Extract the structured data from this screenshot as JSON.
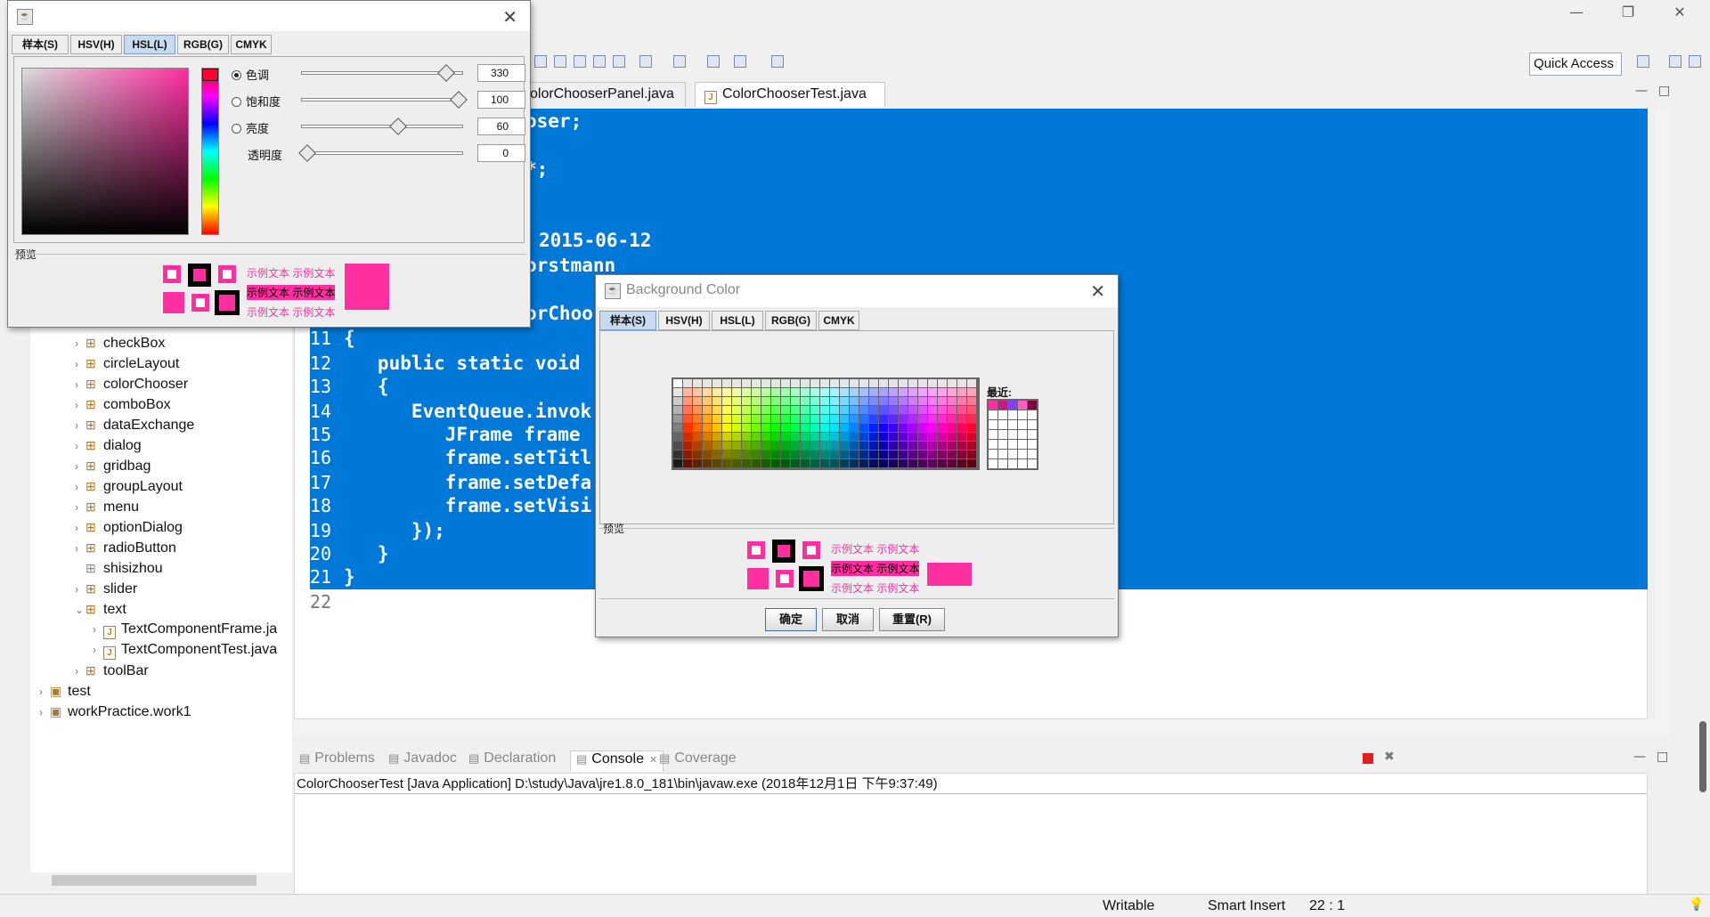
{
  "eclipse": {
    "quick_access": "Quick Access",
    "editor_tabs": [
      "olorChooserPanel.java",
      "ColorChooserTest.java"
    ],
    "code_lines": [
      {
        "num": "",
        "text": "oser;"
      },
      {
        "num": "",
        "text": "*;"
      },
      {
        "num": "",
        "text": "2015-06-12"
      },
      {
        "num": "",
        "text": "orstmann"
      },
      {
        "num": "",
        "text": "orChoo"
      },
      {
        "num": "11",
        "text": "{"
      },
      {
        "num": "12",
        "text": "   public static void"
      },
      {
        "num": "13",
        "text": "   {"
      },
      {
        "num": "14",
        "text": "      EventQueue.invok"
      },
      {
        "num": "15",
        "text": "         JFrame frame"
      },
      {
        "num": "16",
        "text": "         frame.setTitl"
      },
      {
        "num": "17",
        "text": "         frame.setDefa"
      },
      {
        "num": "18",
        "text": "         frame.setVisi"
      },
      {
        "num": "19",
        "text": "      });"
      },
      {
        "num": "20",
        "text": "   }"
      },
      {
        "num": "21",
        "text": "}"
      },
      {
        "num": "22",
        "text": ""
      }
    ],
    "tree": [
      {
        "label": "checkBox",
        "kind": "pkg"
      },
      {
        "label": "circleLayout",
        "kind": "pkg"
      },
      {
        "label": "colorChooser",
        "kind": "pkg"
      },
      {
        "label": "comboBox",
        "kind": "pkg"
      },
      {
        "label": "dataExchange",
        "kind": "pkg"
      },
      {
        "label": "dialog",
        "kind": "pkg"
      },
      {
        "label": "gridbag",
        "kind": "pkg"
      },
      {
        "label": "groupLayout",
        "kind": "pkg"
      },
      {
        "label": "menu",
        "kind": "pkg"
      },
      {
        "label": "optionDialog",
        "kind": "pkg"
      },
      {
        "label": "radioButton",
        "kind": "pkg"
      },
      {
        "label": "shisizhou",
        "kind": "pkg-empty"
      },
      {
        "label": "slider",
        "kind": "pkg"
      },
      {
        "label": "text",
        "kind": "pkg-open"
      },
      {
        "label": "TextComponentFrame.ja",
        "kind": "file"
      },
      {
        "label": "TextComponentTest.java",
        "kind": "file"
      },
      {
        "label": "toolBar",
        "kind": "pkg"
      },
      {
        "label": "test",
        "kind": "project"
      },
      {
        "label": "workPractice.work1",
        "kind": "project"
      }
    ],
    "view_tabs": [
      "Problems",
      "Javadoc",
      "Declaration",
      "Console",
      "Coverage"
    ],
    "console_header": "ColorChooserTest [Java Application] D:\\study\\Java\\jre1.8.0_181\\bin\\javaw.exe (2018年12月1日 下午9:37:49)",
    "status": {
      "writable": "Writable",
      "insert": "Smart Insert",
      "position": "22 : 1"
    }
  },
  "hsl_dialog": {
    "tabs": [
      "样本(S)",
      "HSV(H)",
      "HSL(L)",
      "RGB(G)",
      "CMYK"
    ],
    "active_tab": "HSL(L)",
    "sliders": [
      {
        "label": "色调",
        "value": "330",
        "selected": true,
        "fraction": 0.92
      },
      {
        "label": "饱和度",
        "value": "100",
        "selected": false,
        "fraction": 1.0
      },
      {
        "label": "亮度",
        "value": "60",
        "selected": false,
        "fraction": 0.6
      },
      {
        "label": "透明度",
        "value": "0",
        "selected": false,
        "fraction": 0.0
      }
    ],
    "preview_label": "预览",
    "sample_text": "示例文本",
    "color": "#ff2fa0"
  },
  "bg_dialog": {
    "title": "Background Color",
    "tabs": [
      "样本(S)",
      "HSV(H)",
      "HSL(L)",
      "RGB(G)",
      "CMYK"
    ],
    "active_tab": "样本(S)",
    "recent_label": "最近:",
    "preview_label": "预览",
    "sample_text": "示例文本",
    "ok": "确定",
    "cancel": "取消",
    "reset": "重置(R)",
    "color": "#ff2fa0"
  }
}
